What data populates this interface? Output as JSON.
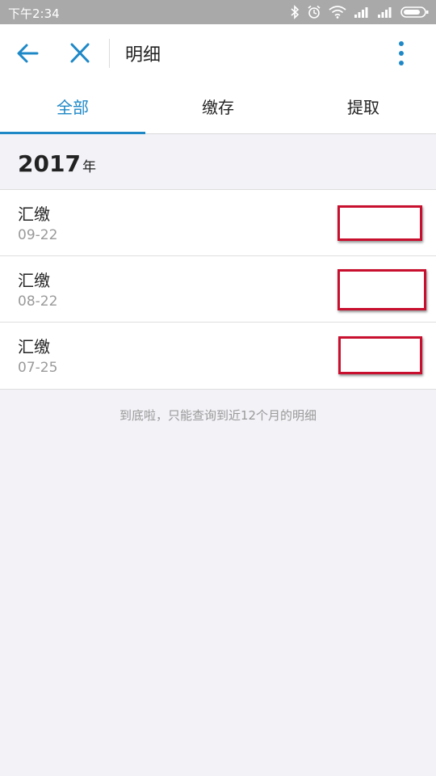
{
  "status_bar": {
    "time": "下午2:34"
  },
  "header": {
    "title": "明细"
  },
  "tabs": [
    {
      "label": "全部",
      "active": true
    },
    {
      "label": "缴存",
      "active": false
    },
    {
      "label": "提取",
      "active": false
    }
  ],
  "section": {
    "year": "2017",
    "year_unit": "年"
  },
  "transactions": [
    {
      "type": "汇缴",
      "date": "09-22"
    },
    {
      "type": "汇缴",
      "date": "08-22"
    },
    {
      "type": "汇缴",
      "date": "07-25"
    }
  ],
  "footer_note": "到底啦，只能查询到近12个月的明细",
  "colors": {
    "accent": "#1e88c7",
    "redaction": "#c8102e"
  }
}
